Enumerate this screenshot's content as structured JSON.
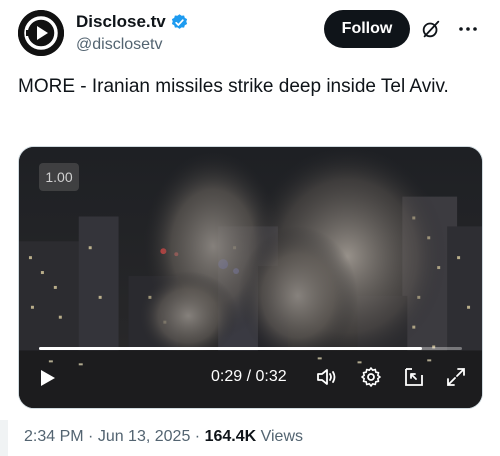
{
  "author": {
    "display_name": "Disclose.tv",
    "handle": "@disclosetv"
  },
  "follow_label": "Follow",
  "tweet_text": "MORE - Iranian missiles strike deep inside Tel Aviv.",
  "video": {
    "speed_label": "1.00",
    "time_label": "0:29 / 0:32",
    "progress": 0.906
  },
  "meta": {
    "time": "2:34 PM",
    "separator1": " · ",
    "date": "Jun 13, 2025",
    "separator2": " · ",
    "views_count": "164.4K",
    "views_label": " Views"
  },
  "colors": {
    "verified_blue": "#1d9bf0",
    "follow_bg": "#0f1419",
    "secondary_text": "#536471"
  },
  "icons": [
    "avatar-logo-icon",
    "verified-badge-icon",
    "grok-icon",
    "more-icon",
    "play-icon",
    "volume-icon",
    "settings-icon",
    "pip-icon",
    "fullscreen-icon"
  ]
}
